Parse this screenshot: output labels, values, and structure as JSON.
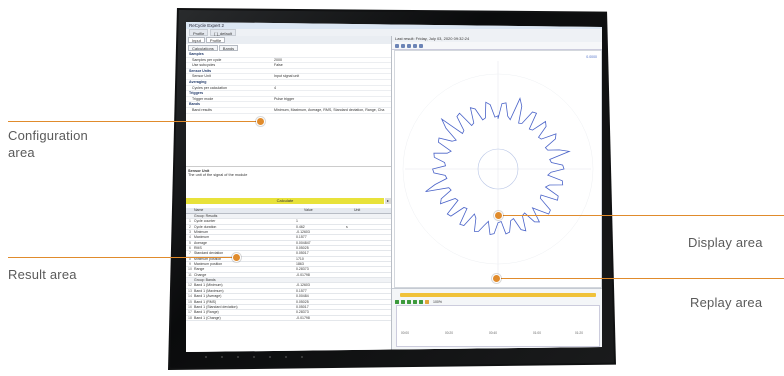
{
  "callouts": {
    "configuration": "Configuration area",
    "configuration_line1": "Configuration",
    "configuration_line2": "area",
    "result": "Result area",
    "display": "Display area",
    "replay": "Replay area"
  },
  "accent_color": "#e08b2c",
  "app": {
    "title": "ReCycle Expert 2",
    "menu": [
      "Profile",
      "[ ]_default"
    ],
    "tabs": [
      "Input",
      "Profile"
    ],
    "subtabs": [
      "Calculations",
      "Bands"
    ]
  },
  "config": {
    "rows": [
      {
        "k": "Samples",
        "v": "",
        "section": true
      },
      {
        "k": "Samples per cycle",
        "v": "2000"
      },
      {
        "k": "Use subcycles",
        "v": "False"
      },
      {
        "k": "Sensor Units",
        "v": "",
        "section": true
      },
      {
        "k": "Sensor Unit",
        "v": "Input signal unit"
      },
      {
        "k": "Averaging",
        "v": "",
        "section": true
      },
      {
        "k": "Cycles per calculation",
        "v": "4"
      },
      {
        "k": "Triggers",
        "v": "",
        "section": true
      },
      {
        "k": "Trigger mode",
        "v": "Pulse trigger"
      },
      {
        "k": "Bands",
        "v": "",
        "section": true
      },
      {
        "k": "Band results",
        "v": "Minimum, Maximum, Average, RMS, Standard deviation, Range, Cha"
      }
    ],
    "hint_title": "Sensor Unit",
    "hint_text": "The unit of the signal of the module"
  },
  "calculate_label": "Calculate",
  "results": {
    "headers": [
      "Name",
      "Value",
      "Unit"
    ],
    "rows": [
      {
        "n": "",
        "nm": "Group: Results",
        "vl": "",
        "un": "",
        "grp": true
      },
      {
        "n": "1",
        "nm": "Cycle counter",
        "vl": "1",
        "un": ""
      },
      {
        "n": "2",
        "nm": "Cycle duration",
        "vl": "0.462",
        "un": "s"
      },
      {
        "n": "3",
        "nm": "Minimum",
        "vl": "-0.12603",
        "un": ""
      },
      {
        "n": "4",
        "nm": "Maximum",
        "vl": "0.1577",
        "un": ""
      },
      {
        "n": "5",
        "nm": "Average",
        "vl": "0.004847",
        "un": ""
      },
      {
        "n": "6",
        "nm": "RMS",
        "vl": "0.05025",
        "un": ""
      },
      {
        "n": "7",
        "nm": "Standard deviation",
        "vl": "0.05017",
        "un": ""
      },
      {
        "n": "8",
        "nm": "Minimum position",
        "vl": "1710",
        "un": ""
      },
      {
        "n": "9",
        "nm": "Maximum position",
        "vl": "1863",
        "un": ""
      },
      {
        "n": "10",
        "nm": "Range",
        "vl": "0.28373",
        "un": ""
      },
      {
        "n": "11",
        "nm": "Change",
        "vl": "-0.01798",
        "un": ""
      },
      {
        "n": "",
        "nm": "Group: Bands",
        "vl": "",
        "un": "",
        "grp": true
      },
      {
        "n": "12",
        "nm": "Band 1 (Minimum)",
        "vl": "-0.12603",
        "un": ""
      },
      {
        "n": "13",
        "nm": "Band 1 (Maximum)",
        "vl": "0.1577",
        "un": ""
      },
      {
        "n": "14",
        "nm": "Band 1 (Average)",
        "vl": "0.00484",
        "un": ""
      },
      {
        "n": "15",
        "nm": "Band 1 (RMS)",
        "vl": "0.05025",
        "un": ""
      },
      {
        "n": "16",
        "nm": "Band 1 (Standard deviation)",
        "vl": "0.05017",
        "un": ""
      },
      {
        "n": "17",
        "nm": "Band 1 (Range)",
        "vl": "0.28373",
        "un": ""
      },
      {
        "n": "18",
        "nm": "Band 1 (Change)",
        "vl": "-0.01798",
        "un": ""
      }
    ]
  },
  "display": {
    "status": "Last result: Friday, July 03, 2020 09:32:24",
    "corner_value": "0.0000"
  },
  "replay": {
    "label": "100%",
    "ticks": [
      "00:00",
      "00:20",
      "00:40",
      "01:00",
      "01:20"
    ]
  }
}
